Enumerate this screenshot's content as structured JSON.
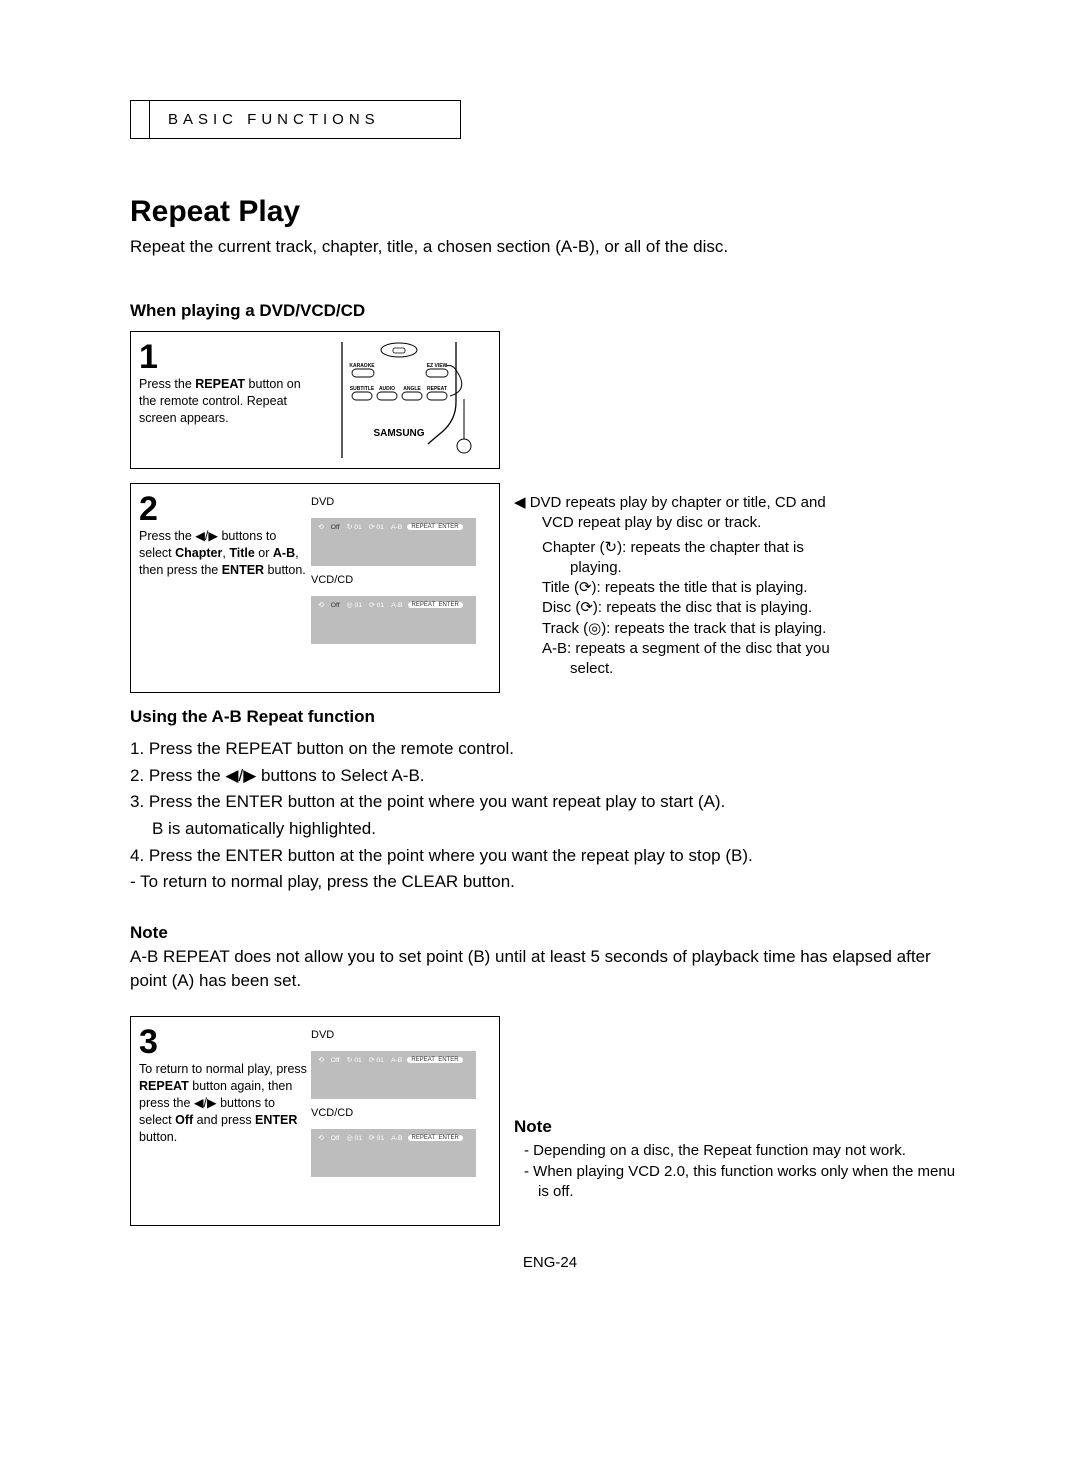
{
  "header": {
    "category": "BASIC FUNCTIONS"
  },
  "title": "Repeat Play",
  "intro": "Repeat the current track, chapter, title, a chosen section (A-B), or all of the disc.",
  "section1_heading": "When playing a DVD/VCD/CD",
  "step1": {
    "num": "1",
    "text_pre": "Press the ",
    "bold1": "REPEAT",
    "text_mid1": " button on the remote control. Repeat screen appears.",
    "remote_labels": {
      "karaoke": "KARAOKE",
      "ezview": "EZ VIEW",
      "subtitle": "SUBTITLE",
      "audio": "AUDIO",
      "angle": "ANGLE",
      "repeat": "REPEAT",
      "brand": "SAMSUNG"
    }
  },
  "step2": {
    "num": "2",
    "text_pre": "Press the ",
    "arrows": "◀/▶",
    "text_mid1": " buttons to select ",
    "bold1": "Chapter",
    "bold2": "Title",
    "bold3": "A-B",
    "text_mid2": ", ",
    "text_mid3": " or ",
    "text_mid4": ", then press the ",
    "bold4": "ENTER",
    "text_end": " button.",
    "dvd_label": "DVD",
    "vcd_label": "VCD/CD",
    "osd": {
      "repeat": "⟲",
      "off": "Off",
      "c": "01",
      "t": "01",
      "ab": "A-B",
      "repeat_enter": "REPEAT  ENTER"
    }
  },
  "right_block": {
    "line1a": "◀ DVD repeats play by chapter or title, CD and",
    "line1b": "VCD repeat play by disc or track.",
    "chapter_pre": "Chapter (",
    "chapter_sym": "↻",
    "chapter_post": "): repeats the chapter that is",
    "chapter_post2": "playing.",
    "title_pre": "Title (",
    "title_sym": "⟳",
    "title_post": "): repeats the title that is playing.",
    "disc_pre": "Disc (",
    "disc_sym": "⟳",
    "disc_post": "): repeats the disc that is playing.",
    "track_pre": "Track (",
    "track_sym": "◎",
    "track_post": "): repeats the track that is playing.",
    "ab_line1": "A-B: repeats a segment of the disc that you",
    "ab_line2": "select."
  },
  "ab_heading": "Using the A-B Repeat function",
  "ab_steps": {
    "l1": "1. Press the REPEAT button on the remote control.",
    "l2": "2. Press the ◀/▶ buttons to Select A-B.",
    "l3": "3. Press the ENTER button at the point where you want repeat play to start (A).",
    "l3b": "B is automatically highlighted.",
    "l4": "4. Press the ENTER button at the point where you want the repeat play to stop (B).",
    "l4b": "- To return to normal play, press the CLEAR button."
  },
  "note1_heading": "Note",
  "note1_body": "A-B REPEAT does not allow you to set point (B) until at least 5 seconds of playback time has elapsed after point (A) has been set.",
  "step3": {
    "num": "3",
    "t1": "To return to normal play, press ",
    "b1": "REPEAT",
    "t2": " button again, then press the ",
    "arrows": "◀/▶",
    "t3": " buttons to select ",
    "b2": "Off",
    "t4": " and press ",
    "b3": "ENTER",
    "t5": " button.",
    "dvd_label": "DVD",
    "vcd_label": "VCD/CD"
  },
  "note2_heading": "Note",
  "note2": {
    "d1": "-  Depending on a disc, the Repeat function may not work.",
    "d2": "-  When playing VCD 2.0, this function works only when the menu is off."
  },
  "page_number": "ENG-24"
}
